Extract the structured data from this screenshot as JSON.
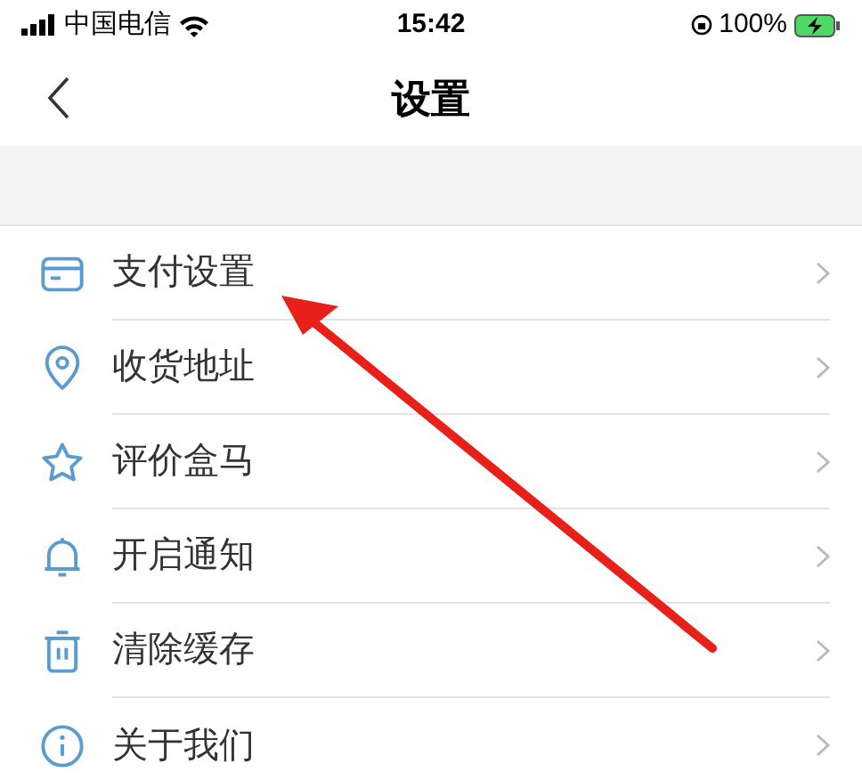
{
  "status_bar": {
    "carrier": "中国电信",
    "time": "15:42",
    "battery": "100%"
  },
  "nav": {
    "title": "设置"
  },
  "items": [
    {
      "kind": "card",
      "label": "支付设置"
    },
    {
      "kind": "pin",
      "label": "收货地址"
    },
    {
      "kind": "star",
      "label": "评价盒马"
    },
    {
      "kind": "bell",
      "label": "开启通知"
    },
    {
      "kind": "trash",
      "label": "清除缓存"
    },
    {
      "kind": "info",
      "label": "关于我们"
    }
  ]
}
